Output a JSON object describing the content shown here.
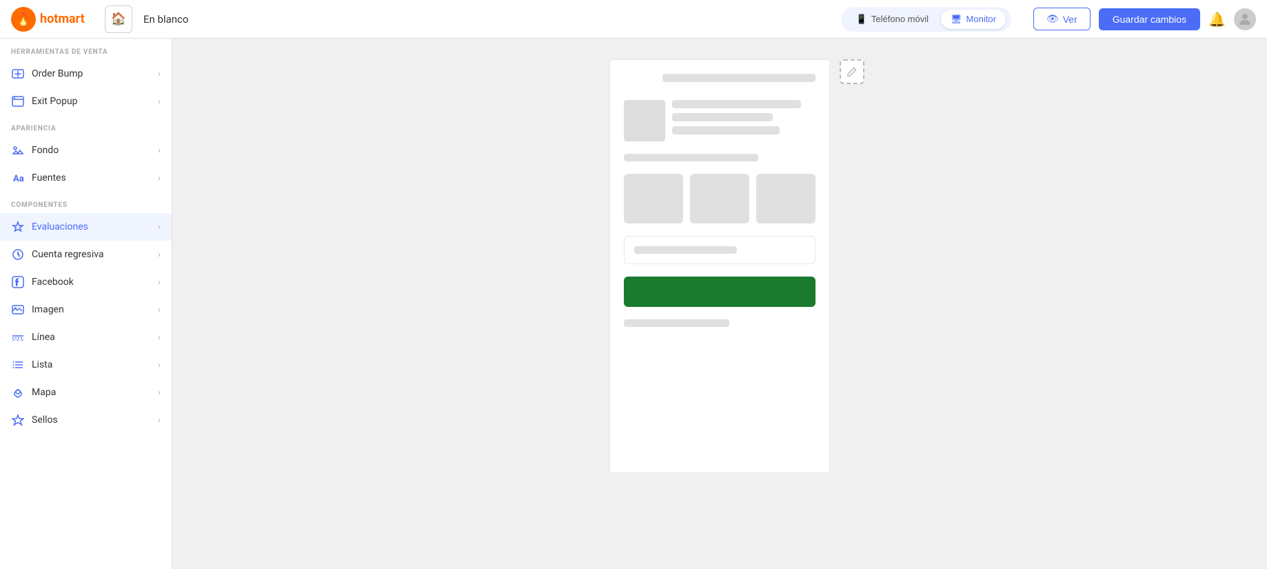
{
  "topbar": {
    "logo_text": "hotmart",
    "home_icon": "🏠",
    "page_title": "En blanco",
    "device_options": [
      {
        "id": "mobile",
        "label": "Teléfono móvil",
        "icon": "📱",
        "active": false
      },
      {
        "id": "monitor",
        "label": "Monitor",
        "icon": "🖥",
        "active": true
      }
    ],
    "btn_ver": "Ver",
    "btn_guardar": "Guardar cambios"
  },
  "sidebar": {
    "sections": [
      {
        "label": "HERRAMIENTAS DE VENTA",
        "items": [
          {
            "id": "order-bump",
            "label": "Order Bump",
            "icon": "bump"
          },
          {
            "id": "exit-popup",
            "label": "Exit Popup",
            "icon": "popup"
          }
        ]
      },
      {
        "label": "APARIENCIA",
        "items": [
          {
            "id": "fondo",
            "label": "Fondo",
            "icon": "fondo"
          },
          {
            "id": "fuentes",
            "label": "Fuentes",
            "icon": "fuentes"
          }
        ]
      },
      {
        "label": "COMPONENTES",
        "items": [
          {
            "id": "evaluaciones",
            "label": "Evaluaciones",
            "icon": "star",
            "active": true
          },
          {
            "id": "cuenta-regresiva",
            "label": "Cuenta regresiva",
            "icon": "clock"
          },
          {
            "id": "facebook",
            "label": "Facebook",
            "icon": "facebook"
          },
          {
            "id": "imagen",
            "label": "Imagen",
            "icon": "image"
          },
          {
            "id": "linea",
            "label": "Línea",
            "icon": "line"
          },
          {
            "id": "lista",
            "label": "Lista",
            "icon": "list"
          },
          {
            "id": "mapa",
            "label": "Mapa",
            "icon": "map"
          },
          {
            "id": "sellos",
            "label": "Sellos",
            "icon": "seal"
          }
        ]
      }
    ]
  },
  "canvas": {
    "edit_icon": "✏️"
  },
  "icons": {
    "bell": "🔔",
    "eye": "👁",
    "chevron_right": "›",
    "mobile": "📱",
    "monitor": "🖥"
  }
}
